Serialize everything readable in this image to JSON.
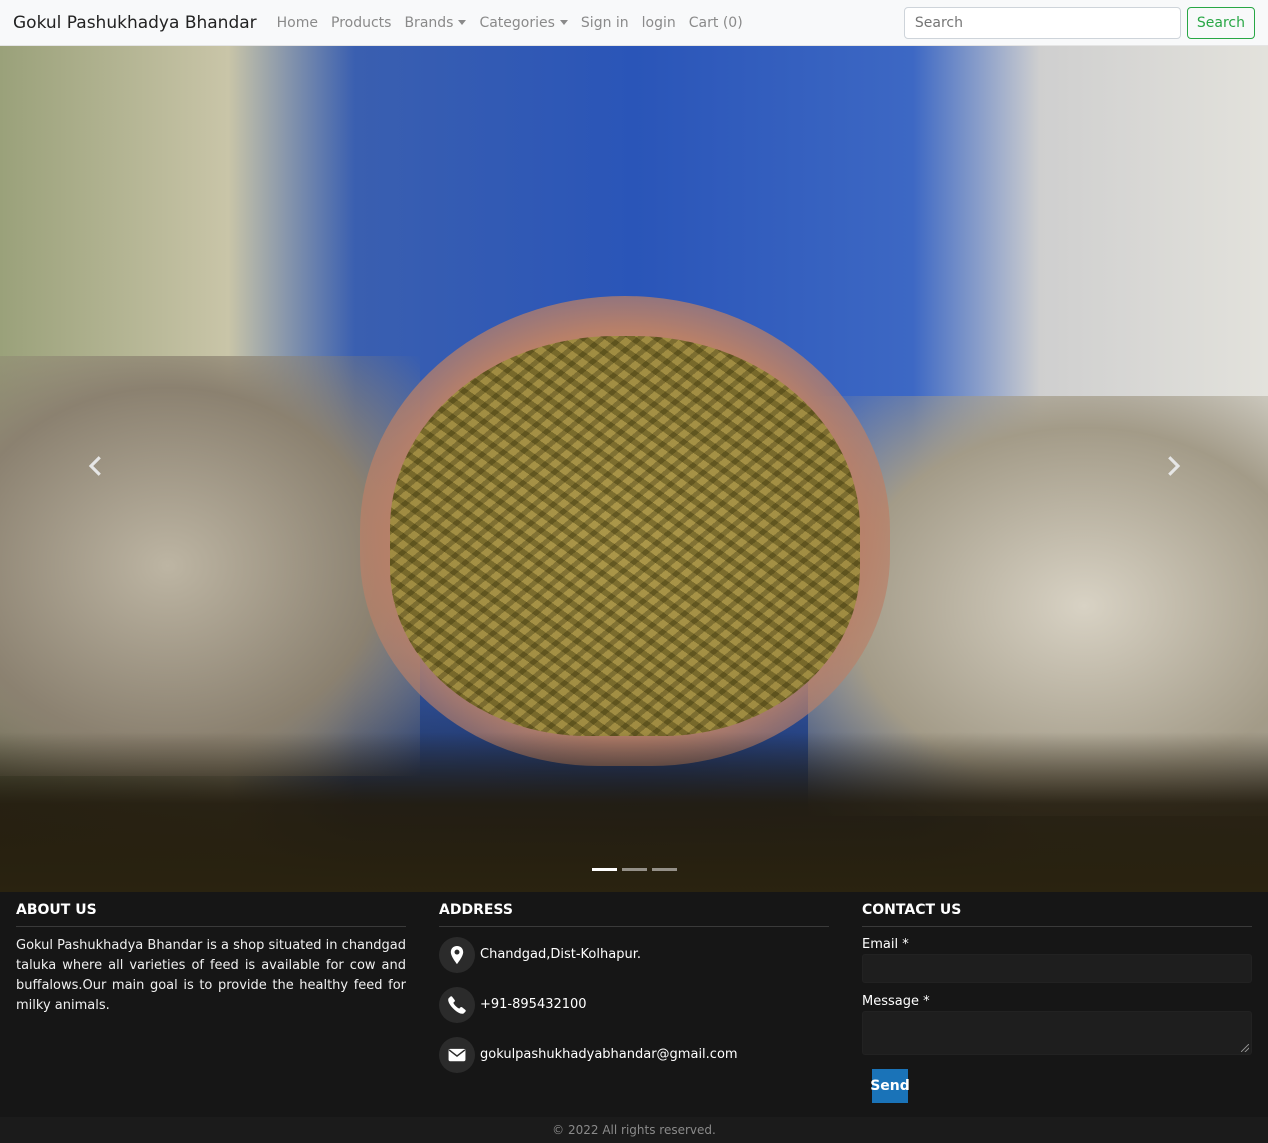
{
  "navbar": {
    "brand": "Gokul Pashukhadya Bhandar",
    "links": [
      "Home",
      "Products",
      "Brands",
      "Categories",
      "Sign in",
      "login",
      "Cart (0)"
    ],
    "search_placeholder": "Search",
    "search_button": "Search"
  },
  "carousel": {
    "slide_count": 3,
    "active_index": 0,
    "image_description_icon": "pellet-feed-hands-image"
  },
  "about": {
    "heading": "ABOUT US",
    "text": "Gokul Pashukhadya Bhandar is a shop situated in chandgad taluka where all varieties of feed is available for cow and buffalows.Our main goal is to provide the healthy feed for milky animals."
  },
  "address": {
    "heading": "ADDRESS",
    "location": "Chandgad,Dist-Kolhapur.",
    "phone": "+91-895432100",
    "email": "gokulpashukhadyabhandar@gmail.com"
  },
  "contact": {
    "heading": "CONTACT US",
    "email_label": "Email *",
    "message_label": "Message *",
    "send_button": "Send"
  },
  "footer": {
    "copyright": "© 2022 All rights reserved."
  },
  "colors": {
    "navbar_bg": "#f8f9fa",
    "search_accent": "#28a745",
    "send_button": "#1a73b8",
    "page_bg": "#161616"
  }
}
